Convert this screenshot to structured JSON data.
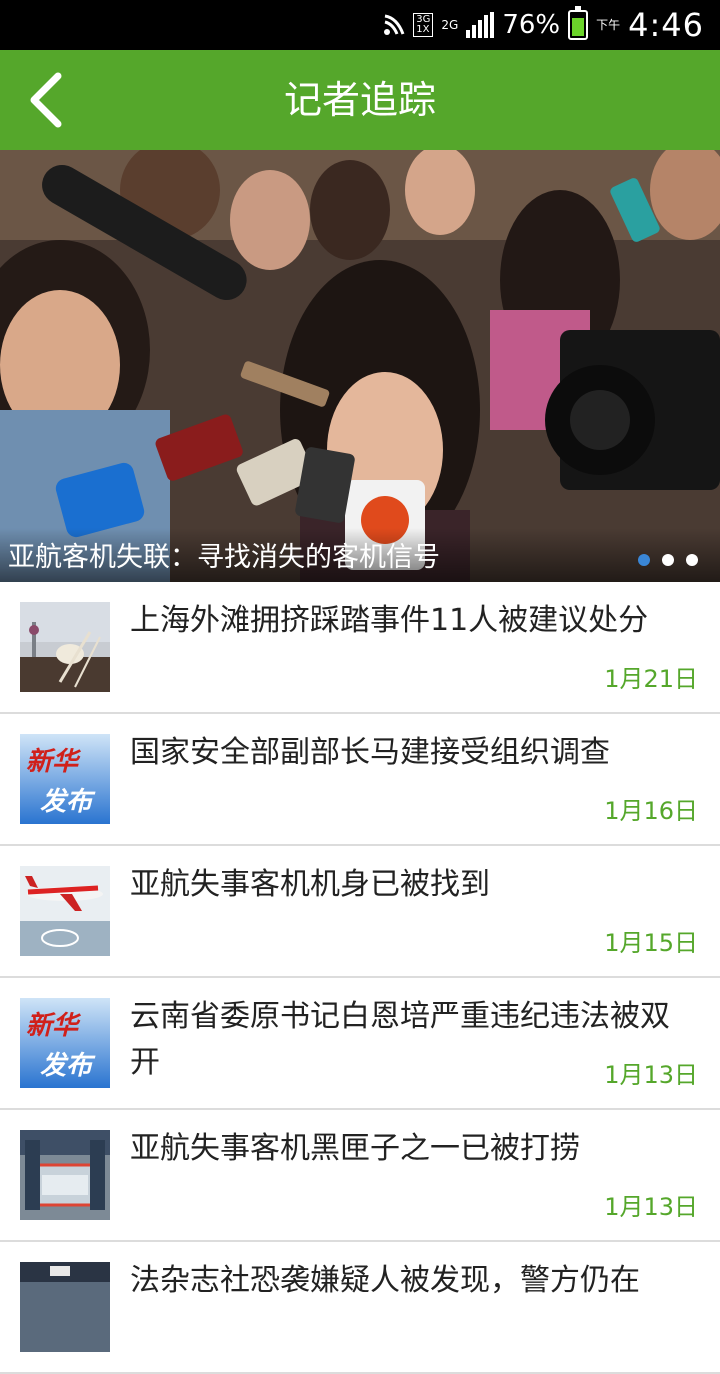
{
  "status_bar": {
    "network_top": "3G",
    "network_bottom": "1X",
    "network2": "2G",
    "battery_percent": "76%",
    "period": "下午",
    "time": "4:46"
  },
  "header": {
    "title": "记者追踪",
    "back_icon": "back-chevron-icon"
  },
  "banner": {
    "caption": "亚航客机失联：寻找消失的客机信号",
    "page_count": 3,
    "active_page": 1
  },
  "news": [
    {
      "title": "上海外滩拥挤踩踏事件11人被建议处分",
      "date": "1月21日",
      "thumb": "shanghai-bund"
    },
    {
      "title": "国家安全部副部长马建接受组织调查",
      "date": "1月16日",
      "thumb": "xinhua-release"
    },
    {
      "title": "亚航失事客机机身已被找到",
      "date": "1月15日",
      "thumb": "airplane"
    },
    {
      "title": "云南省委原书记白恩培严重违纪违法被双开",
      "date": "1月13日",
      "thumb": "xinhua-release"
    },
    {
      "title": "亚航失事客机黑匣子之一已被打捞",
      "date": "1月13日",
      "thumb": "blackbox"
    },
    {
      "title": "法杂志社恐袭嫌疑人被发现，警方仍在",
      "date": "",
      "thumb": "police"
    }
  ],
  "colors": {
    "accent": "#55a72b",
    "status_bg": "#000000",
    "divider": "#dcdcdc"
  }
}
